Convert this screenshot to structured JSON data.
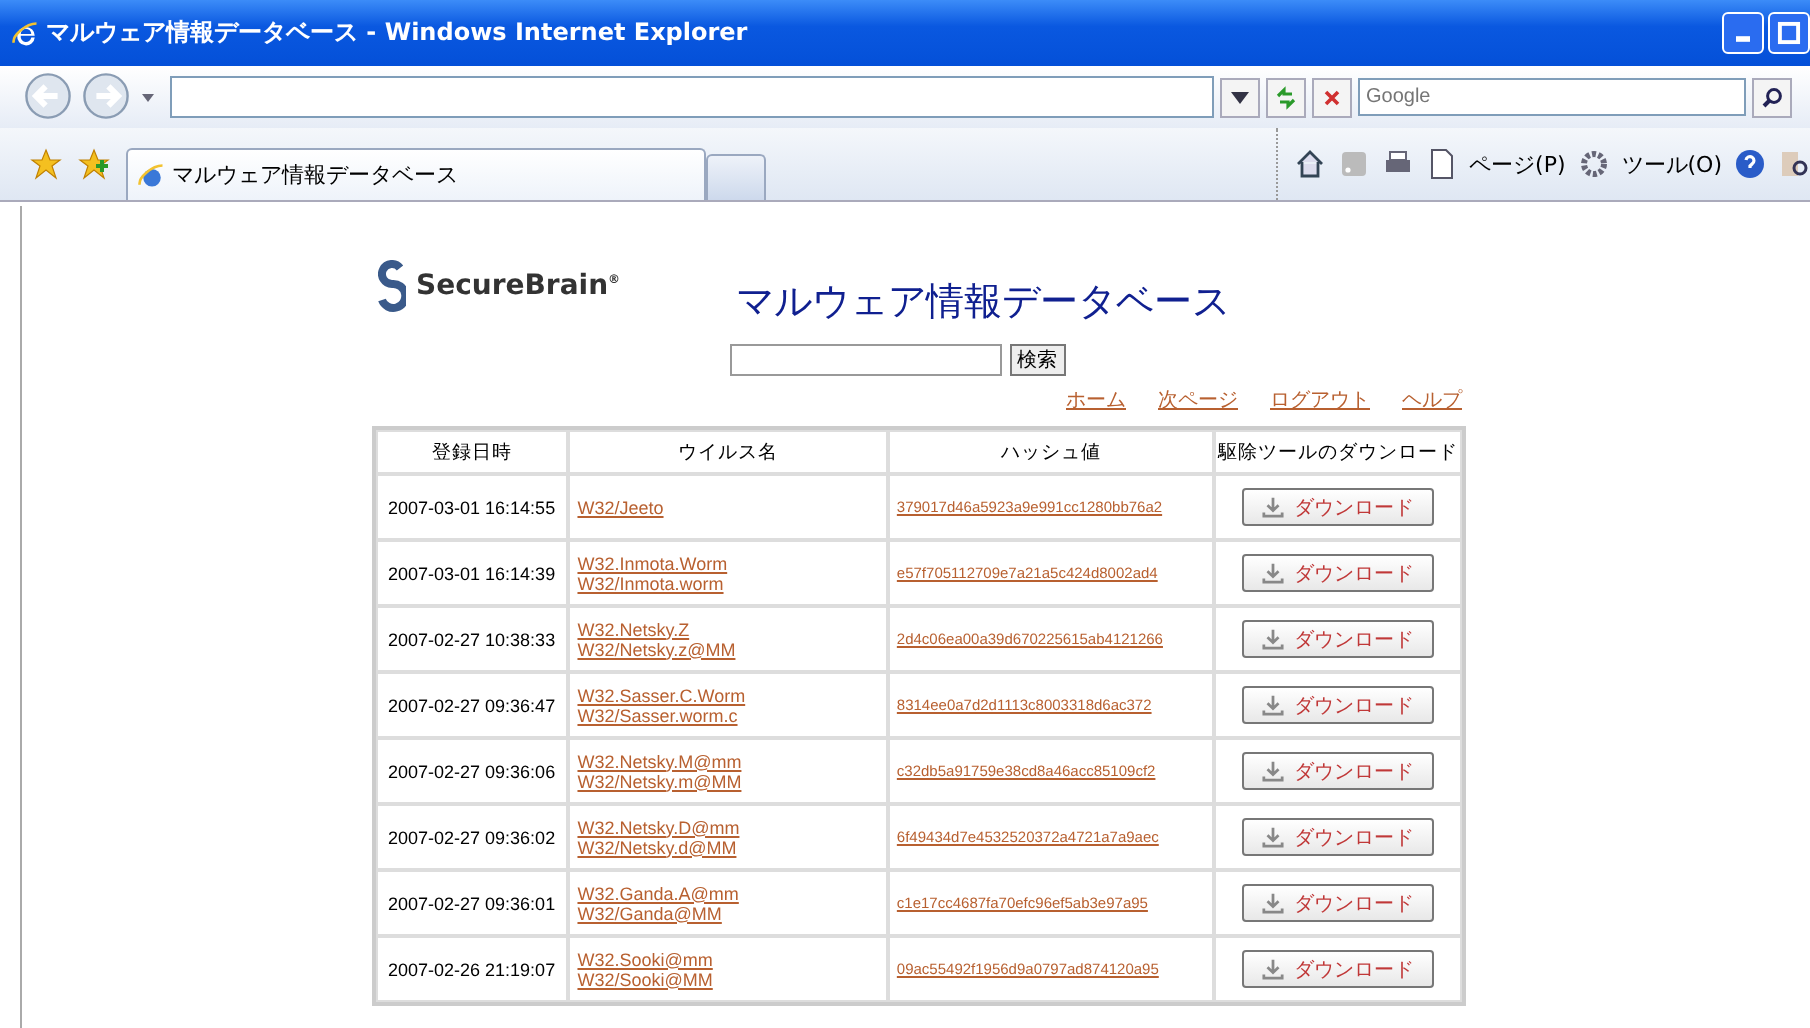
{
  "window": {
    "title": "マルウェア情報データベース - Windows Internet Explorer"
  },
  "address_bar": {
    "search_placeholder": "Google"
  },
  "tabs": [
    {
      "label": "マルウェア情報データベース",
      "selected": true
    }
  ],
  "toolbar": [
    "ページ(P)",
    "ツール(O)"
  ],
  "page": {
    "logo": "SecureBrain",
    "logo_mark": "®",
    "title": "マルウェア情報データベース",
    "search_button": "検索",
    "links": [
      "ホーム",
      "次ページ",
      "ログアウト",
      "ヘルプ"
    ],
    "table": {
      "columns": [
        "登録日時",
        "ウイルス名",
        "ハッシュ値",
        "駆除ツールのダウンロード"
      ],
      "rows": [
        {
          "date": "2007-03-01 16:14:55",
          "names": [
            "W32/Jeeto"
          ],
          "hash": "379017d46a5923a9e991cc1280bb76a2",
          "button": "ダウンロード"
        },
        {
          "date": "2007-03-01 16:14:39",
          "names": [
            "W32.Inmota.Worm",
            "W32/Inmota.worm"
          ],
          "hash": "e57f705112709e7a21a5c424d8002ad4",
          "button": "ダウンロード"
        },
        {
          "date": "2007-02-27 10:38:33",
          "names": [
            "W32.Netsky.Z",
            "W32/Netsky.z@MM"
          ],
          "hash": "2d4c06ea00a39d670225615ab4121266",
          "button": "ダウンロード"
        },
        {
          "date": "2007-02-27 09:36:47",
          "names": [
            "W32.Sasser.C.Worm",
            "W32/Sasser.worm.c"
          ],
          "hash": "8314ee0a7d2d1113c8003318d6ac372",
          "button": "ダウンロード"
        },
        {
          "date": "2007-02-27 09:36:06",
          "names": [
            "W32.Netsky.M@mm",
            "W32/Netsky.m@MM"
          ],
          "hash": "c32db5a91759e38cd8a46acc85109cf2",
          "button": "ダウンロード"
        },
        {
          "date": "2007-02-27 09:36:02",
          "names": [
            "W32.Netsky.D@mm",
            "W32/Netsky.d@MM"
          ],
          "hash": "6f49434d7e4532520372a4721a7a9aec",
          "button": "ダウンロード"
        },
        {
          "date": "2007-02-27 09:36:01",
          "names": [
            "W32.Ganda.A@mm",
            "W32/Ganda@MM"
          ],
          "hash": "c1e17cc4687fa70efc96ef5ab3e97a95",
          "button": "ダウンロード"
        },
        {
          "date": "2007-02-26 21:19:07",
          "names": [
            "W32.Sooki@mm",
            "W32/Sooki@MM"
          ],
          "hash": "09ac55492f1956d9a0797ad874120a95",
          "button": "ダウンロード"
        }
      ]
    }
  }
}
